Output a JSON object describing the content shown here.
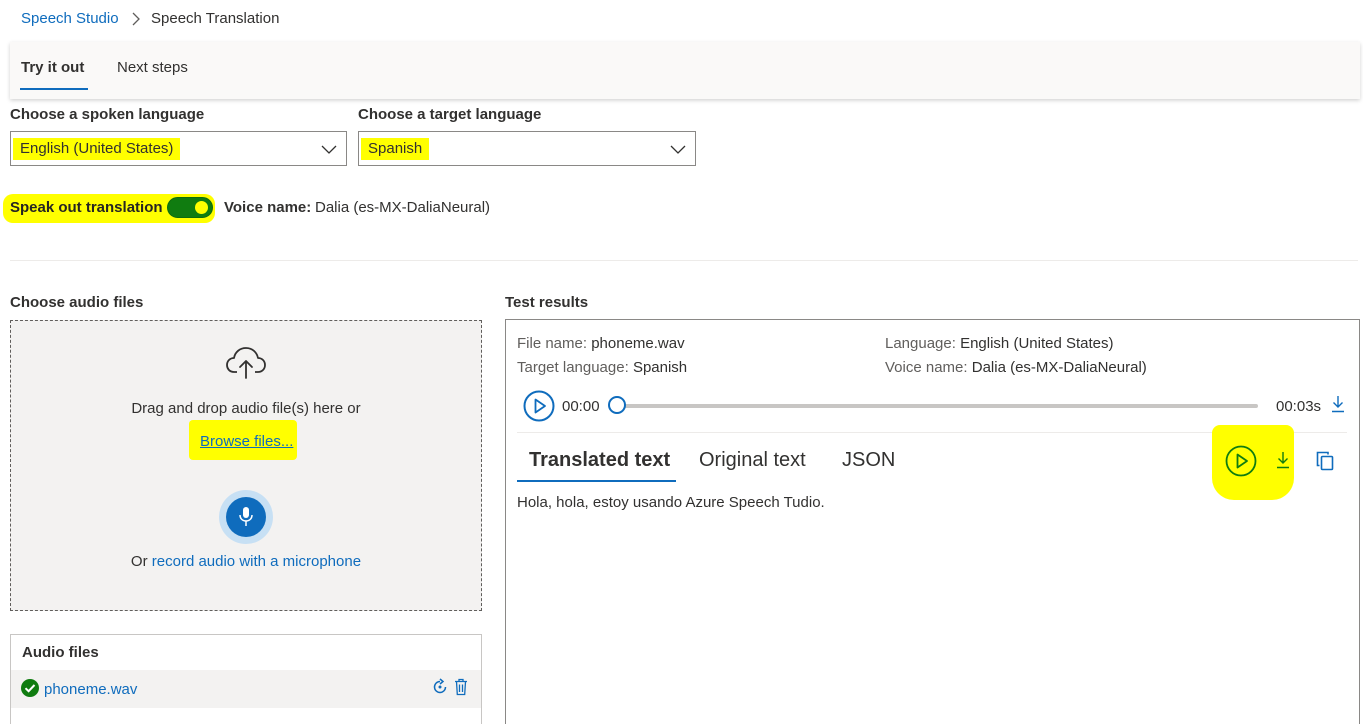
{
  "breadcrumb": {
    "root": "Speech Studio",
    "current": "Speech Translation"
  },
  "tabs": {
    "try": "Try it out",
    "next": "Next steps"
  },
  "spoken": {
    "label": "Choose a spoken language",
    "value": "English (United States)"
  },
  "target": {
    "label": "Choose a target language",
    "value": "Spanish"
  },
  "speak": {
    "label": "Speak out translation",
    "on": true,
    "voice_label": "Voice name:",
    "voice_value": "Dalia (es-MX-DaliaNeural)"
  },
  "upload": {
    "title": "Choose audio files",
    "drag_text": "Drag and drop audio file(s) here or",
    "browse": "Browse files...",
    "record_prefix": "Or ",
    "record_link": "record audio with a microphone"
  },
  "audio_files": {
    "title": "Audio files",
    "items": [
      {
        "name": "phoneme.wav"
      }
    ]
  },
  "results": {
    "title": "Test results",
    "file_label": "File name:",
    "file_value": "phoneme.wav",
    "target_label": "Target language:",
    "target_value": "Spanish",
    "lang_label": "Language:",
    "lang_value": "English (United States)",
    "voice_label": "Voice name:",
    "voice_value": "Dalia (es-MX-DaliaNeural)",
    "time_start": "00:00",
    "time_end": "00:03s",
    "tabs": [
      "Translated text",
      "Original text",
      "JSON"
    ],
    "text": "Hola, hola, estoy usando Azure Speech Tudio."
  },
  "colors": {
    "accent": "#0f6cbd",
    "highlight": "#ffff00",
    "toggle_on": "#107c10"
  }
}
